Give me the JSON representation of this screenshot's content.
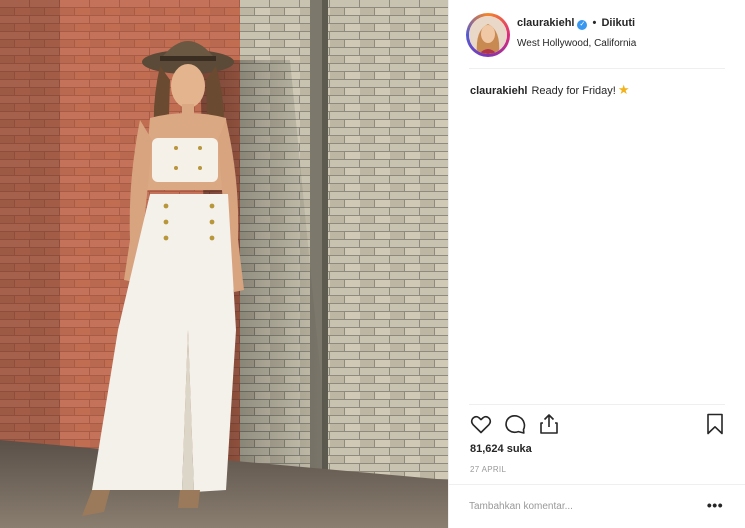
{
  "post": {
    "username": "claurakiehl",
    "follow_status": "Diikuti",
    "separator": "•",
    "location": "West Hollywood, California",
    "caption_username": "claurakiehl",
    "caption_text": "Ready for Friday!",
    "caption_emoji": "★",
    "likes": "81,624 suka",
    "date": "27 APRIL"
  },
  "comment": {
    "placeholder": "Tambahkan komentar...",
    "more_label": "•••"
  },
  "icons": {
    "verified": "verified-badge-icon",
    "like": "heart-icon",
    "comment": "comment-icon",
    "share": "share-icon",
    "save": "bookmark-icon"
  },
  "colors": {
    "verified": "#3897f0",
    "divider": "#efefef",
    "muted": "#999999",
    "text": "#262626"
  }
}
